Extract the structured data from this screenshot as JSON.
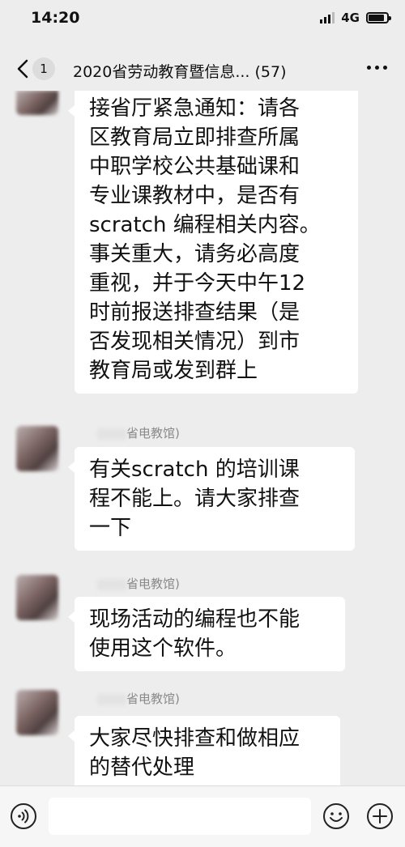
{
  "status_bar": {
    "time": "14:20",
    "network": "4G",
    "battery_level": 0.85
  },
  "nav": {
    "back_icon": "chevron-left-icon",
    "unread_count": "1",
    "title": "2020省劳动教育暨信息... (57)",
    "more_icon": "more-dots-icon"
  },
  "messages": [
    {
      "sender": "",
      "lines": [
        "接省厅紧急通知：请各",
        "区教育局立即排查所属",
        "中职学校公共基础课和",
        "专业课教材中，是否有",
        "scratch 编程相关内容。",
        "事关重大，请务必高度",
        "重视，并于今天中午12",
        "时前报送排查结果（是",
        "否发现相关情况）到市",
        "教育局或发到群上"
      ]
    },
    {
      "sender": "省电教馆)",
      "lines": [
        "有关scratch 的培训课",
        "程不能上。请大家排查",
        "一下"
      ]
    },
    {
      "sender": "省电教馆)",
      "lines": [
        "现场活动的编程也不能",
        "使用这个软件。"
      ]
    },
    {
      "sender": "省电教馆)",
      "lines": [
        "大家尽快排查和做相应",
        "的替代处理"
      ]
    }
  ],
  "input_bar": {
    "voice_icon": "voice-icon",
    "emoji_icon": "emoji-icon",
    "plus_icon": "plus-icon"
  }
}
